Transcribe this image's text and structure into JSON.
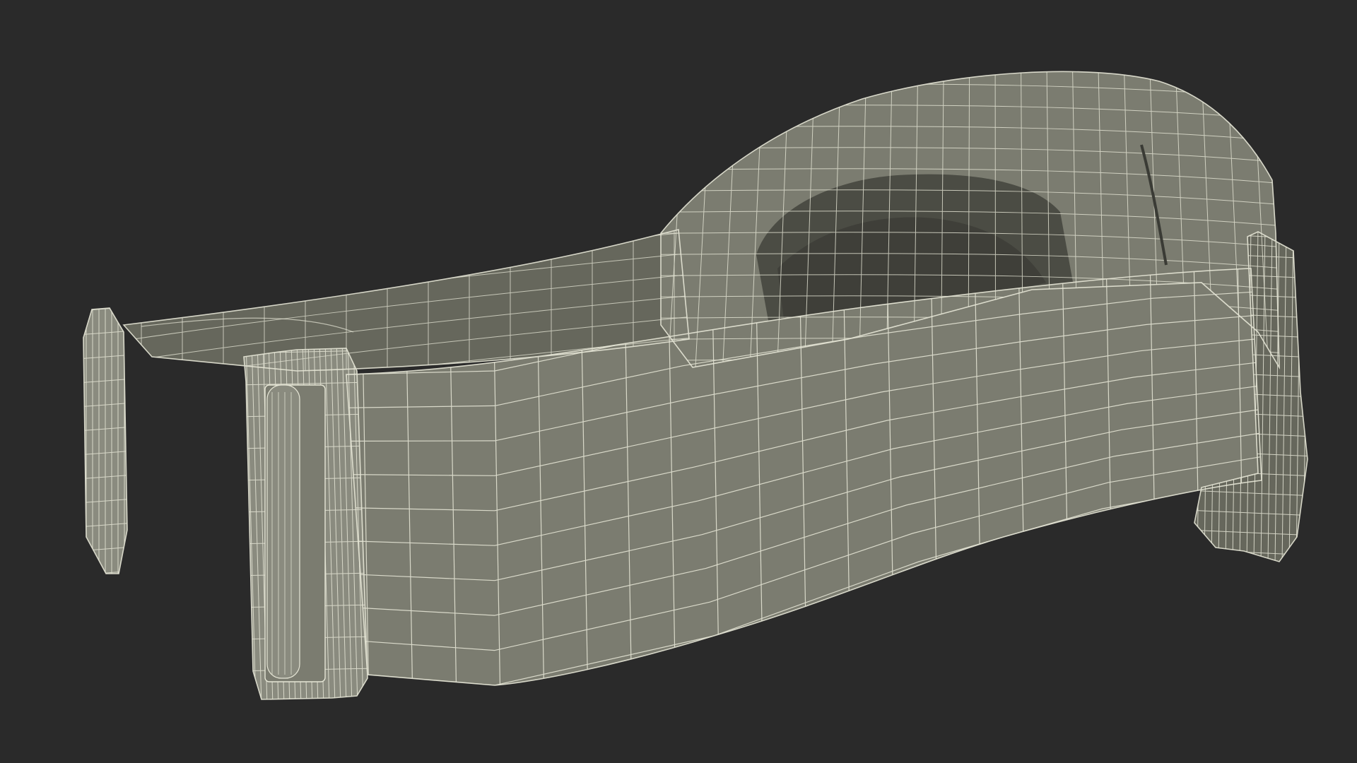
{
  "scene": {
    "subject": "wireframe-goggles",
    "colors": {
      "background": "#2a2a2a",
      "surface": "#7b7c70",
      "surface_light": "#8a8b7f",
      "surface_dark": "#66675c",
      "interior": "#4b4c44",
      "interior_deep": "#3a3b35",
      "wire": "#e6e6d6"
    }
  }
}
